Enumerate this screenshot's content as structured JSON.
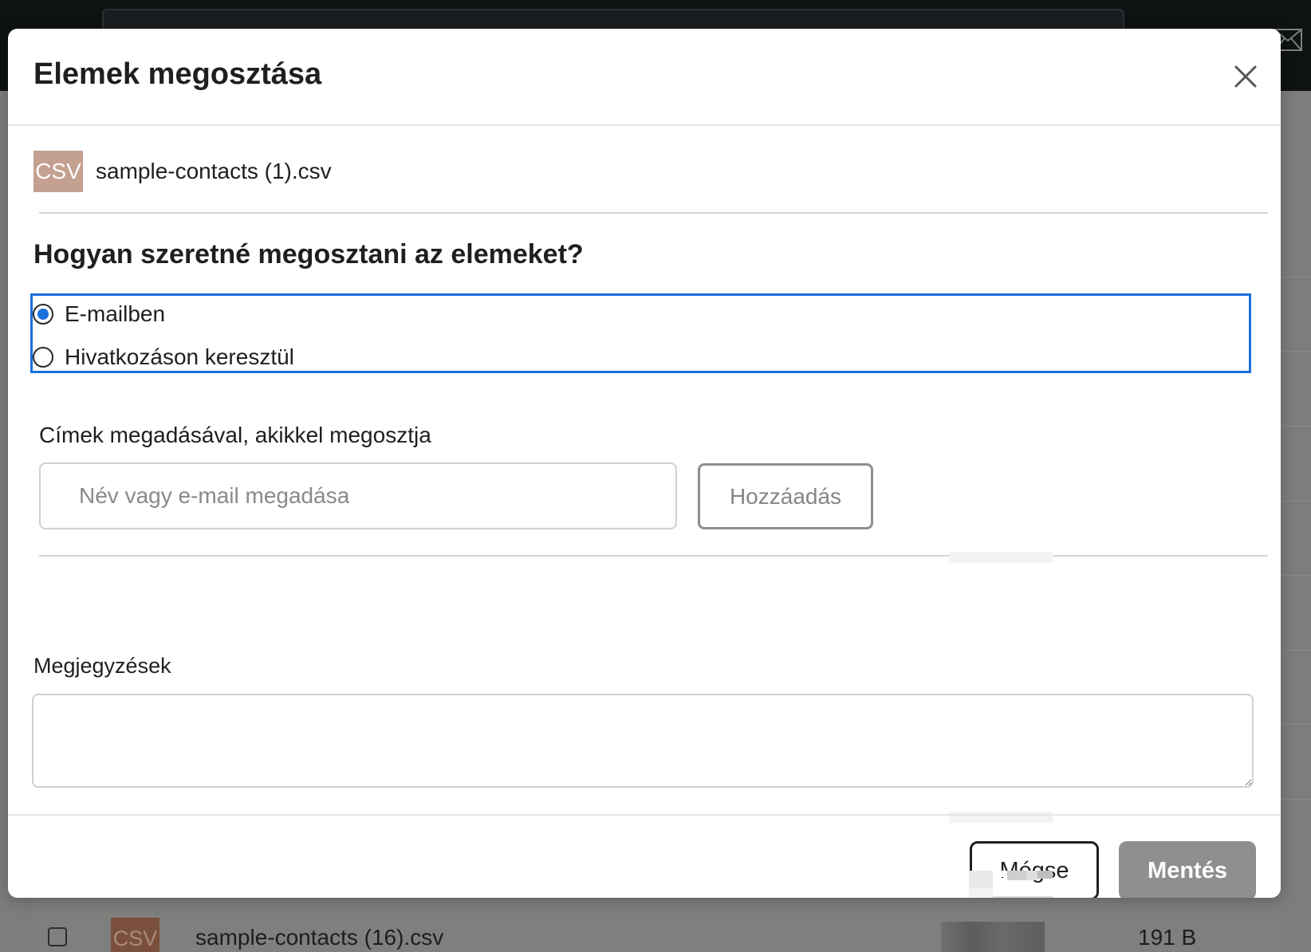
{
  "background": {
    "row": {
      "badge": "CSV",
      "file_name": "sample-contacts (16).csv",
      "size": "191 B"
    }
  },
  "modal": {
    "title": "Elemek megosztása",
    "file": {
      "badge": "CSV",
      "name": "sample-contacts (1).csv"
    },
    "question": "Hogyan szeretné megosztani az elemeket?",
    "share_options": [
      {
        "label": "E-mailben",
        "selected": true
      },
      {
        "label": "Hivatkozáson keresztül",
        "selected": false
      }
    ],
    "recipients_label": "Címek megadásával, akikkel megosztja",
    "recipient_input": {
      "placeholder": "Név vagy e-mail megadása",
      "value": ""
    },
    "add_button": "Hozzáadás",
    "notes_label": "Megjegyzések",
    "notes_value": "",
    "cancel_button": "Mégse",
    "save_button": "Mentés"
  },
  "colors": {
    "accent": "#1a6fdc",
    "csv_badge": "#c4a090",
    "disabled_button": "#8f8f8f",
    "overlay": "#7d7e7c"
  }
}
